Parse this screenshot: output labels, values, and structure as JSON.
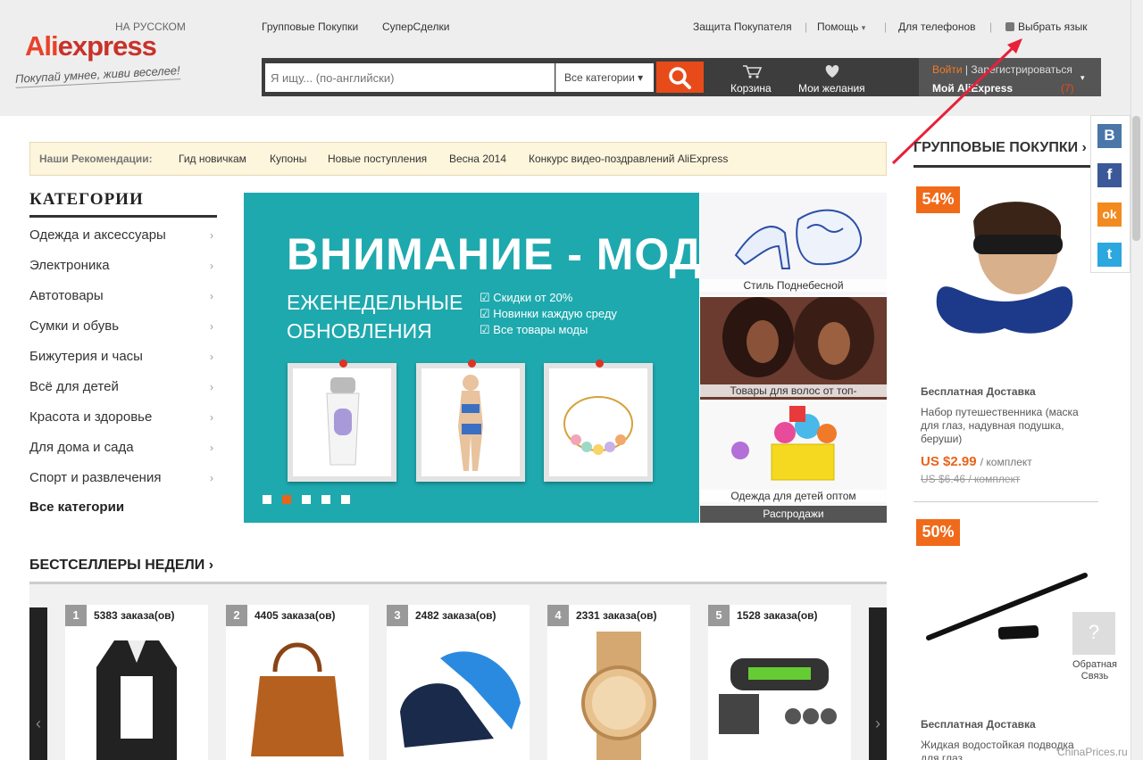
{
  "header": {
    "logo_sub": "НА РУССКОМ",
    "logo_ali": "Ali",
    "logo_express": "express",
    "logo_express_x": "x",
    "logo_express_rest": "press",
    "slogan": "Покупай умнее, живи веселее!",
    "nav_left": [
      "Групповые Покупки",
      "СуперСделки"
    ],
    "nav_right": [
      "Защита Покупателя",
      "Помощь",
      "Для телефонов",
      "Выбрать язык"
    ],
    "help_arrow": "▾",
    "lang_icon": "globe-icon"
  },
  "search": {
    "placeholder": "Я ищу... (по-английски)",
    "category": "Все категории ▾",
    "button_icon": "search-icon"
  },
  "cart": {
    "label": "Корзина",
    "icon": "cart-icon"
  },
  "wishlist": {
    "label": "Мои желания",
    "icon": "heart-icon"
  },
  "account": {
    "login": "Войти",
    "separator": " | ",
    "register": "Зарегистрироваться",
    "my": "Мой AliExpress",
    "count": "(7)",
    "arrow": "▾"
  },
  "recommendations": {
    "title": "Наши Рекомендации:",
    "links": [
      "Гид новичкам",
      "Купоны",
      "Новые поступления",
      "Весна 2014",
      "Конкурс видео-поздравлений AliExpress"
    ]
  },
  "categories": {
    "title": "КАТЕГОРИИ",
    "chevron": "›",
    "items": [
      "Одежда и аксессуары",
      "Электроника",
      "Автотовары",
      "Сумки и обувь",
      "Бижутерия и часы",
      "Всё для детей",
      "Красота и здоровье",
      "Для дома и сада",
      "Спорт и развлечения"
    ],
    "all": "Все категории"
  },
  "banner": {
    "title": "ВНИМАНИЕ - МОДА!",
    "subtitle_1": "ЕЖЕНЕДЕЛЬНЫЕ",
    "subtitle_2": "ОБНОВЛЕНИЯ",
    "bullets": [
      "Скидки от 20%",
      "Новинки каждую среду",
      "Все товары моды"
    ],
    "checkbox_icon": "☑",
    "active_slide": 2,
    "slides": 5
  },
  "tiles": [
    {
      "caption": "Стиль Поднебесной"
    },
    {
      "caption": "Товары для волос от топ-"
    },
    {
      "caption": "Одежда для детей оптом"
    }
  ],
  "sale_label": "Распродажи",
  "bestsellers": {
    "title": "БЕСТСЕЛЛЕРЫ НЕДЕЛИ",
    "title_arrow": "›",
    "prev": "‹",
    "next": "›",
    "items": [
      {
        "rank": "1",
        "orders": "5383 заказа(ов)"
      },
      {
        "rank": "2",
        "orders": "4405 заказа(ов)"
      },
      {
        "rank": "3",
        "orders": "2482 заказа(ов)"
      },
      {
        "rank": "4",
        "orders": "2331 заказа(ов)"
      },
      {
        "rank": "5",
        "orders": "1528 заказа(ов)"
      }
    ]
  },
  "group_buys": {
    "title": "ГРУППОВЫЕ ПОКУПКИ",
    "title_arrow": "›",
    "items": [
      {
        "discount": "54%",
        "shipping": "Бесплатная Доставка",
        "desc": "Набор путешественника (маска для глаз, надувная подушка, беруши)",
        "price": "US $2.99",
        "unit": "/ комплект",
        "old_price": "US $6.46 / комплект"
      },
      {
        "discount": "50%",
        "shipping": "Бесплатная Доставка",
        "desc": "Жидкая водостойкая подводка для глаз"
      }
    ]
  },
  "social": {
    "vk": "В",
    "facebook": "f",
    "odnoklassniki": "ok",
    "twitter": "t"
  },
  "feedback": {
    "label": "Обратная Связь",
    "icon": "feedback-icon"
  },
  "watermark": "ChinaPrices.ru",
  "colors": {
    "accent": "#e84b1a",
    "banner": "#1ea9ae",
    "header": "#eeeeee",
    "searchbar": "#3d3d3d"
  }
}
